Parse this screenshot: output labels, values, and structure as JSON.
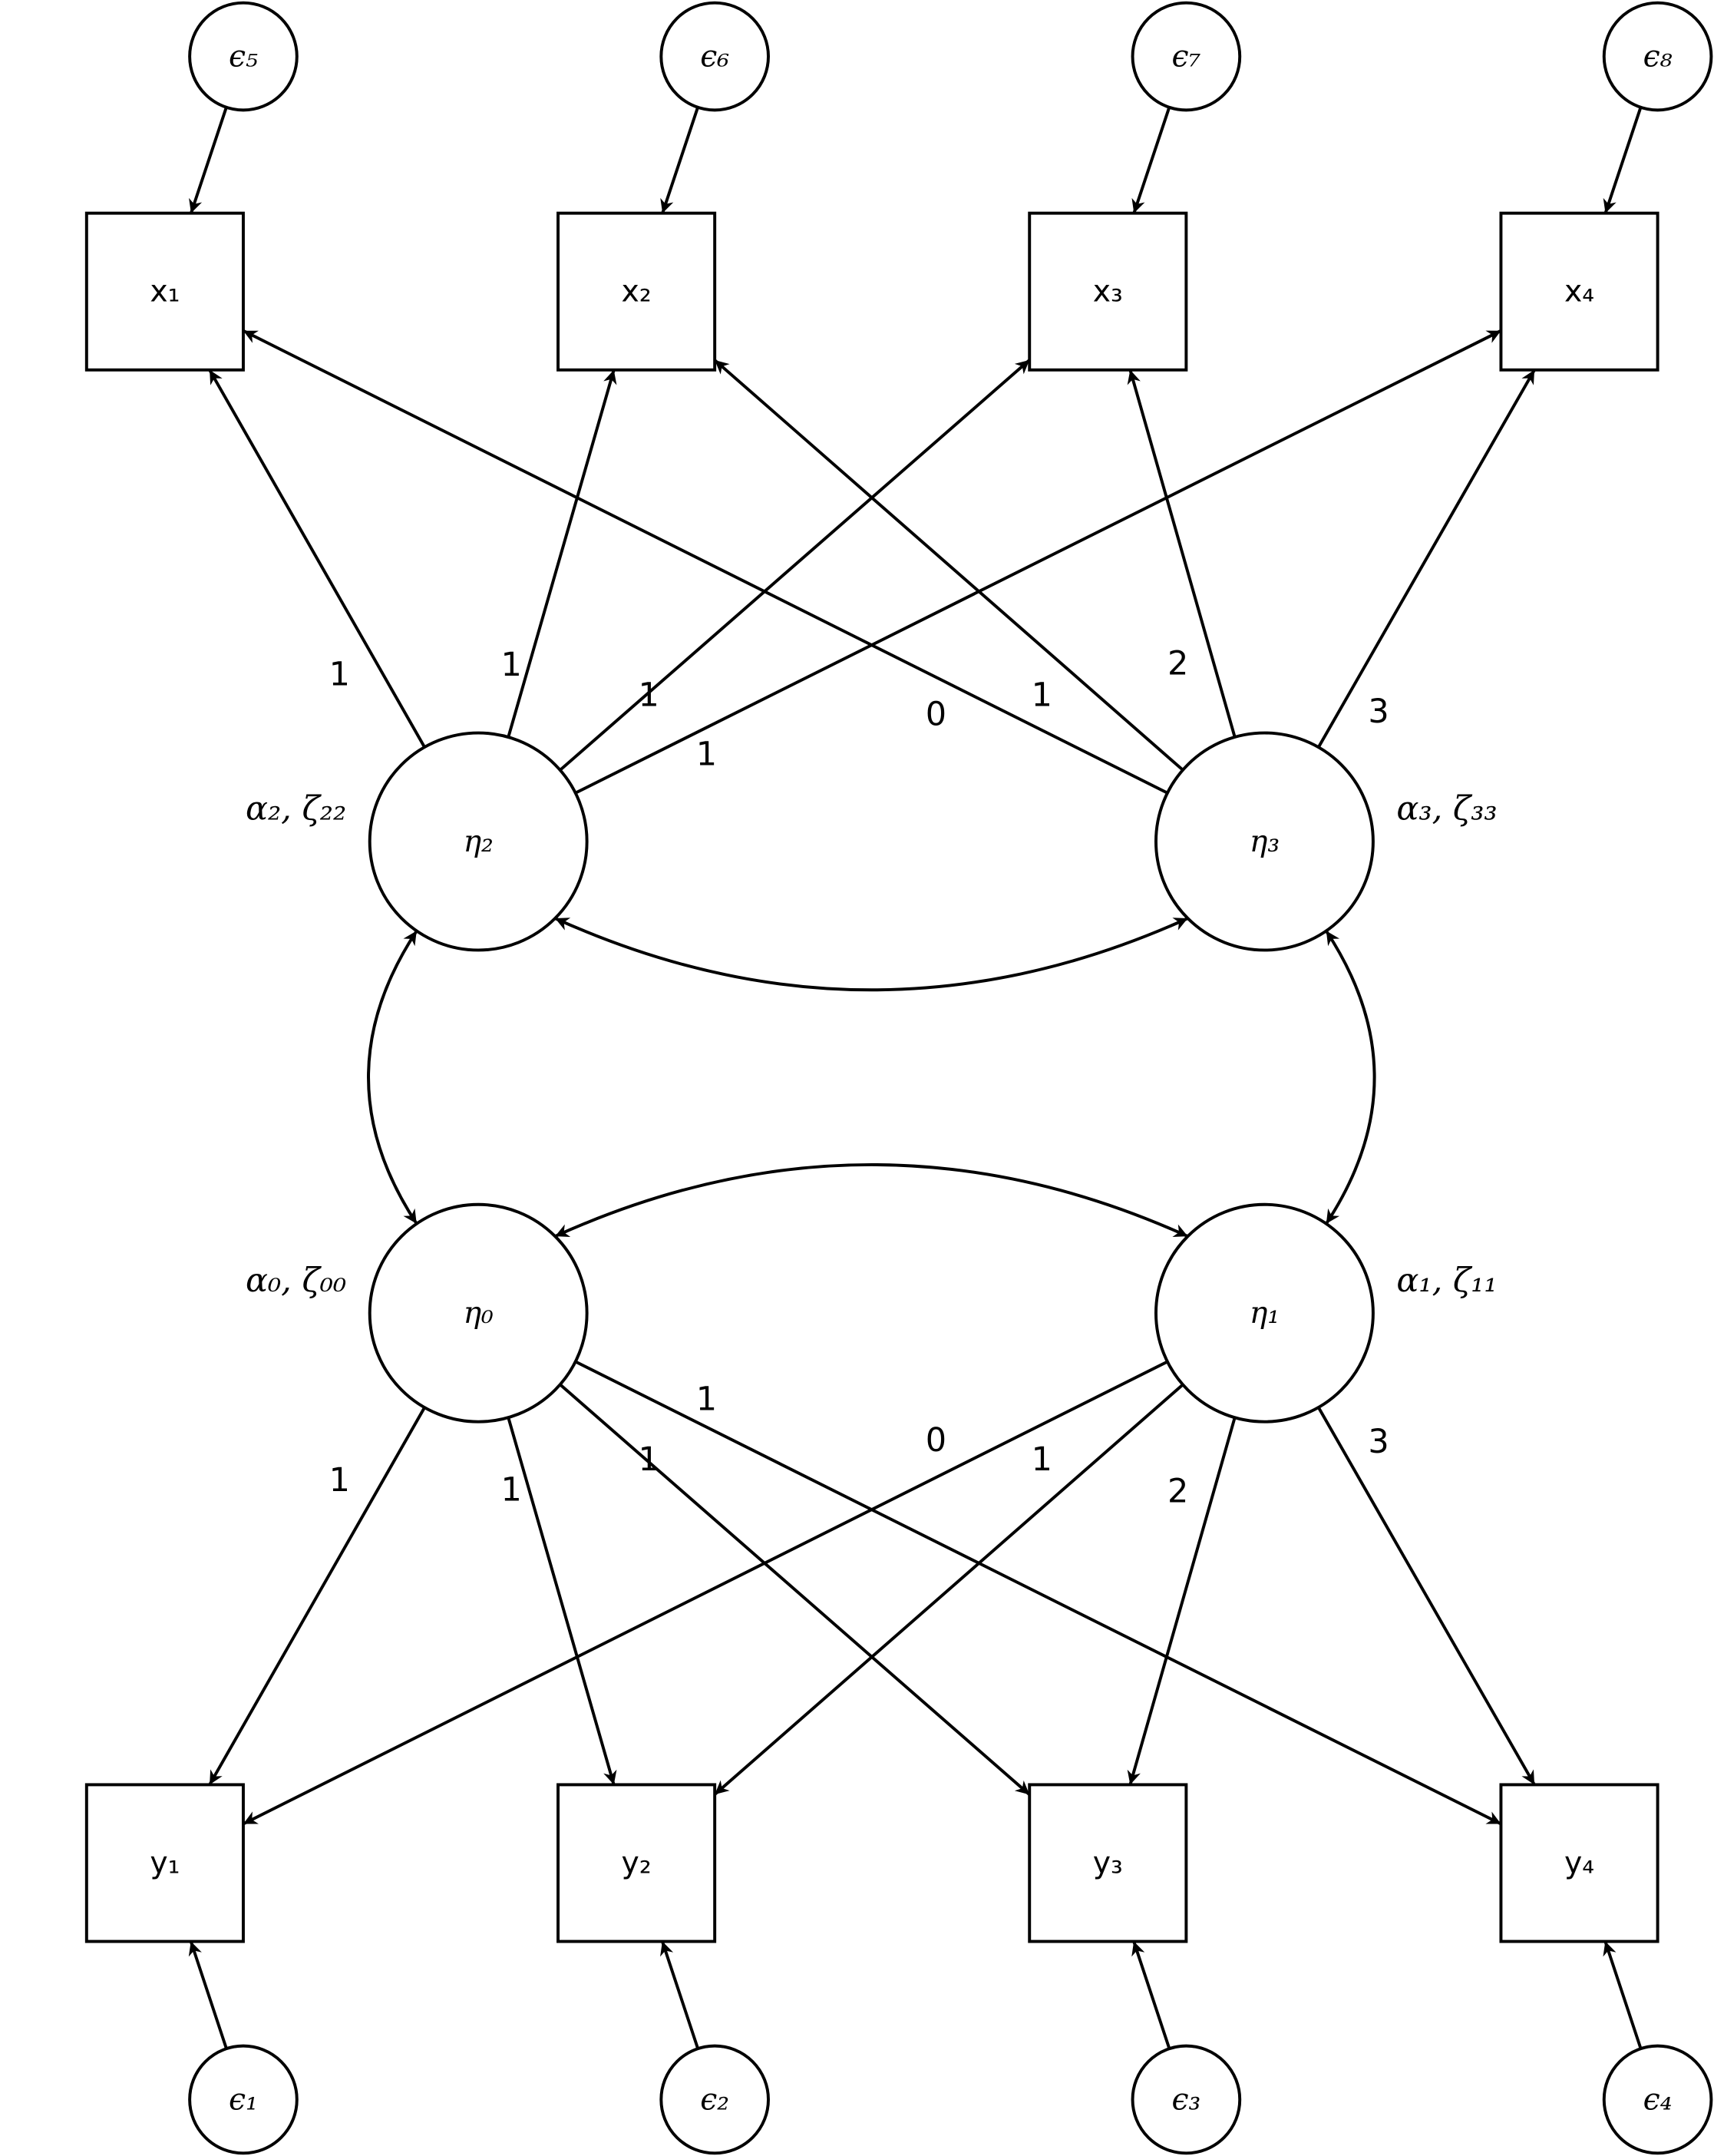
{
  "diagram": {
    "type": "structural-equation-model",
    "latent": [
      {
        "id": "eta2",
        "label": "η₂",
        "param": "α₂, ζ₂₂"
      },
      {
        "id": "eta3",
        "label": "η₃",
        "param": "α₃, ζ₃₃"
      },
      {
        "id": "eta0",
        "label": "η₀",
        "param": "α₀, ζ₀₀"
      },
      {
        "id": "eta1",
        "label": "η₁",
        "param": "α₁, ζ₁₁"
      }
    ],
    "observed_top": [
      {
        "id": "x1",
        "label": "x₁"
      },
      {
        "id": "x2",
        "label": "x₂"
      },
      {
        "id": "x3",
        "label": "x₃"
      },
      {
        "id": "x4",
        "label": "x₄"
      }
    ],
    "observed_bottom": [
      {
        "id": "y1",
        "label": "y₁"
      },
      {
        "id": "y2",
        "label": "y₂"
      },
      {
        "id": "y3",
        "label": "y₃"
      },
      {
        "id": "y4",
        "label": "y₄"
      }
    ],
    "errors_top": [
      {
        "id": "e5",
        "label": "ϵ₅",
        "target": "x1"
      },
      {
        "id": "e6",
        "label": "ϵ₆",
        "target": "x2"
      },
      {
        "id": "e7",
        "label": "ϵ₇",
        "target": "x3"
      },
      {
        "id": "e8",
        "label": "ϵ₈",
        "target": "x4"
      }
    ],
    "errors_bottom": [
      {
        "id": "e1",
        "label": "ϵ₁",
        "target": "y1"
      },
      {
        "id": "e2",
        "label": "ϵ₂",
        "target": "y2"
      },
      {
        "id": "e3",
        "label": "ϵ₃",
        "target": "y3"
      },
      {
        "id": "e4",
        "label": "ϵ₄",
        "target": "y4"
      }
    ],
    "loadings": [
      {
        "from": "eta2",
        "to": "x1",
        "weight": "1"
      },
      {
        "from": "eta2",
        "to": "x2",
        "weight": "1"
      },
      {
        "from": "eta2",
        "to": "x3",
        "weight": "1"
      },
      {
        "from": "eta2",
        "to": "x4",
        "weight": "1"
      },
      {
        "from": "eta3",
        "to": "x1",
        "weight": "0"
      },
      {
        "from": "eta3",
        "to": "x2",
        "weight": "1"
      },
      {
        "from": "eta3",
        "to": "x3",
        "weight": "2"
      },
      {
        "from": "eta3",
        "to": "x4",
        "weight": "3"
      },
      {
        "from": "eta0",
        "to": "y1",
        "weight": "1"
      },
      {
        "from": "eta0",
        "to": "y2",
        "weight": "1"
      },
      {
        "from": "eta0",
        "to": "y3",
        "weight": "1"
      },
      {
        "from": "eta0",
        "to": "y4",
        "weight": "1"
      },
      {
        "from": "eta1",
        "to": "y1",
        "weight": "0"
      },
      {
        "from": "eta1",
        "to": "y2",
        "weight": "1"
      },
      {
        "from": "eta1",
        "to": "y3",
        "weight": "2"
      },
      {
        "from": "eta1",
        "to": "y4",
        "weight": "3"
      }
    ],
    "covariances": [
      {
        "a": "eta2",
        "b": "eta3"
      },
      {
        "a": "eta0",
        "b": "eta1"
      },
      {
        "a": "eta2",
        "b": "eta0"
      },
      {
        "a": "eta3",
        "b": "eta1"
      }
    ]
  }
}
